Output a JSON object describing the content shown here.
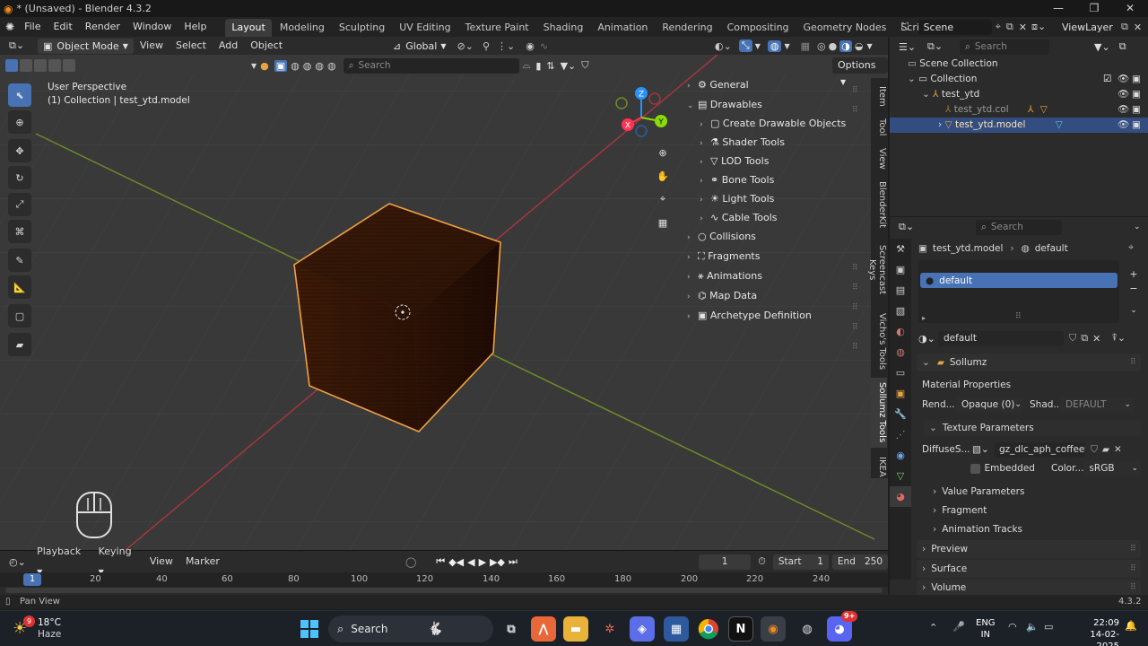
{
  "window": {
    "title": "* (Unsaved) - Blender 4.3.2"
  },
  "menubar": {
    "items": [
      "File",
      "Edit",
      "Render",
      "Window",
      "Help"
    ],
    "workspaces": [
      "Layout",
      "Modeling",
      "Sculpting",
      "UV Editing",
      "Texture Paint",
      "Shading",
      "Animation",
      "Rendering",
      "Compositing",
      "Geometry Nodes",
      "Scripting"
    ],
    "add_tab": "+",
    "scene": "Scene",
    "view_layer": "ViewLayer"
  },
  "viewport": {
    "mode": "Object Mode",
    "menus": [
      "View",
      "Select",
      "Add",
      "Object"
    ],
    "orientation": "Global",
    "search_placeholder": "Search",
    "options": "Options",
    "overlay_line1": "User Perspective",
    "overlay_line2": "(1) Collection | test_ytd.model",
    "gizmo": {
      "x": "X",
      "y": "Y",
      "z": "Z"
    }
  },
  "npanel": {
    "rows": [
      "General",
      "Drawables",
      "Create Drawable Objects",
      "Shader Tools",
      "LOD Tools",
      "Bone Tools",
      "Light Tools",
      "Cable Tools",
      "Collisions",
      "Fragments",
      "Animations",
      "Map Data",
      "Archetype Definition"
    ],
    "tabs": [
      "Item",
      "Tool",
      "View",
      "BlenderKit",
      "Screencast Keys",
      "Vicho's Tools",
      "Sollumz Tools",
      "IKEA"
    ]
  },
  "timeline": {
    "menus": [
      "Playback",
      "Keying",
      "View",
      "Marker"
    ],
    "current_frame": "1",
    "start_label": "Start",
    "start": "1",
    "end_label": "End",
    "end": "250",
    "ticks": [
      "1",
      "20",
      "40",
      "60",
      "80",
      "100",
      "120",
      "140",
      "160",
      "180",
      "200",
      "220",
      "240"
    ]
  },
  "outliner": {
    "search_placeholder": "Search",
    "rows": [
      "Scene Collection",
      "Collection",
      "test_ytd",
      "test_ytd.col",
      "test_ytd.model"
    ]
  },
  "properties": {
    "search_placeholder": "Search",
    "breadcrumb_object": "test_ytd.model",
    "breadcrumb_material": "default",
    "slot_name": "default",
    "material_name": "default",
    "sollumz_header": "Sollumz",
    "material_properties": "Material Properties",
    "render_label": "Rend...",
    "render_value": "Opaque (0)",
    "shader_label": "Shad...",
    "shader_value": "DEFAULT",
    "texture_params": "Texture Parameters",
    "diffuse_label": "DiffuseS...",
    "diffuse_value": "gz_dlc_aph_coffeeta...",
    "embedded": "Embedded",
    "color_label": "Color...",
    "color_value": "sRGB",
    "subpanels": [
      "Value Parameters",
      "Fragment",
      "Animation Tracks"
    ],
    "panels": [
      "Preview",
      "Surface",
      "Volume"
    ]
  },
  "statusbar": {
    "left": "Pan View",
    "version": "4.3.2"
  },
  "taskbar": {
    "weather_temp": "18°C",
    "weather_desc": "Haze",
    "weather_badge": "9",
    "search": "Search",
    "lang1": "ENG",
    "lang2": "IN",
    "time": "22:09",
    "date": "14-02-2025",
    "discord_badge": "9+"
  },
  "colors": {
    "accent": "#4772b3",
    "selected_outline": "#f0a040",
    "x_axis": "#ff3352",
    "y_axis": "#8bdc00",
    "z_axis": "#2890ff"
  }
}
